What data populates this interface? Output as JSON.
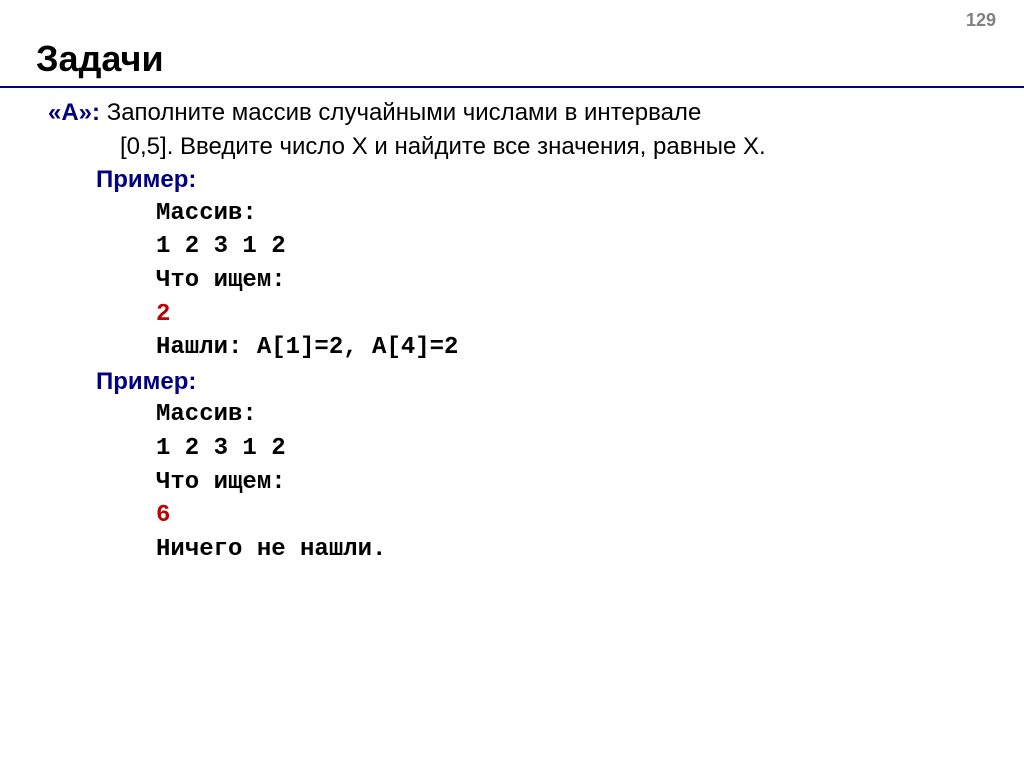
{
  "page_number": "129",
  "title": "Задачи",
  "task": {
    "label": "«A»:",
    "text_line1": " Заполните массив случайными числами в интервале",
    "text_line2": "[0,5]. Введите число X и найдите все значения, равные X."
  },
  "example1": {
    "label": "Пример:",
    "lines": {
      "l1": "Массив:",
      "l2": "1 2 3 1 2",
      "l3": "Что ищем:",
      "l4": "2",
      "l5": "Нашли: A[1]=2, A[4]=2"
    }
  },
  "example2": {
    "label": "Пример:",
    "lines": {
      "l1": "Массив:",
      "l2": "1 2 3 1 2",
      "l3": "Что ищем:",
      "l4": "6",
      "l5": "Ничего не нашли."
    }
  }
}
